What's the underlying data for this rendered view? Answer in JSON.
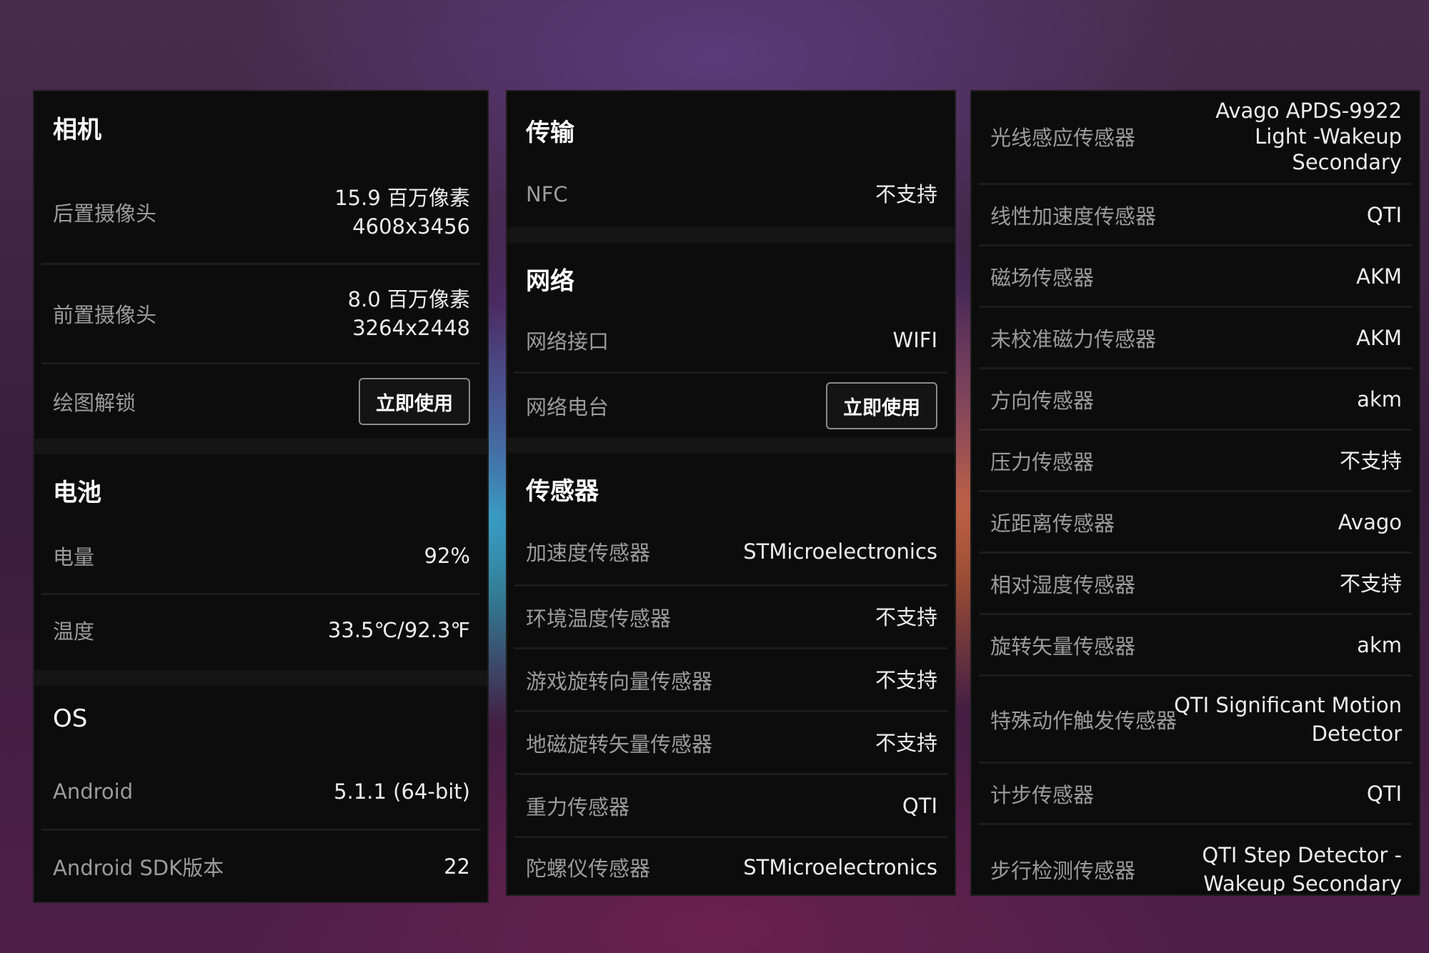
{
  "camera": {
    "title": "相机",
    "rear": {
      "label": "后置摄像头",
      "line1": "15.9 百万像素",
      "line2": "4608x3456"
    },
    "front": {
      "label": "前置摄像头",
      "line1": "8.0 百万像素",
      "line2": "3264x2448"
    },
    "unlock": {
      "label": "绘图解锁",
      "button": "立即使用"
    }
  },
  "battery": {
    "title": "电池",
    "level": {
      "label": "电量",
      "value": "92%"
    },
    "temp": {
      "label": "温度",
      "value": "33.5℃/92.3℉"
    }
  },
  "os": {
    "title": "OS",
    "android": {
      "label": "Android",
      "value": "5.1.1 (64-bit)"
    },
    "sdk": {
      "label": "Android SDK版本",
      "value": "22"
    }
  },
  "transfer": {
    "title": "传输",
    "nfc": {
      "label": "NFC",
      "value": "不支持"
    }
  },
  "network": {
    "title": "网络",
    "iface": {
      "label": "网络接口",
      "value": "WIFI"
    },
    "radio": {
      "label": "网络电台",
      "button": "立即使用"
    }
  },
  "sensors": {
    "title": "传感器",
    "items": [
      {
        "label": "加速度传感器",
        "value": "STMicroelectronics"
      },
      {
        "label": "环境温度传感器",
        "value": "不支持"
      },
      {
        "label": "游戏旋转向量传感器",
        "value": "不支持"
      },
      {
        "label": "地磁旋转矢量传感器",
        "value": "不支持"
      },
      {
        "label": "重力传感器",
        "value": "QTI"
      },
      {
        "label": "陀螺仪传感器",
        "value": "STMicroelectronics"
      }
    ]
  },
  "sensors2": {
    "light": {
      "label": "光线感应传感器",
      "line1": "Avago APDS-9922",
      "line2": "Light -Wakeup",
      "line3": "Secondary"
    },
    "items": [
      {
        "label": "线性加速度传感器",
        "value": "QTI"
      },
      {
        "label": "磁场传感器",
        "value": "AKM"
      },
      {
        "label": "未校准磁力传感器",
        "value": "AKM"
      },
      {
        "label": "方向传感器",
        "value": "akm"
      },
      {
        "label": "压力传感器",
        "value": "不支持"
      },
      {
        "label": "近距离传感器",
        "value": "Avago"
      },
      {
        "label": "相对湿度传感器",
        "value": "不支持"
      },
      {
        "label": "旋转矢量传感器",
        "value": "akm"
      }
    ],
    "motion": {
      "label": "特殊动作触发传感器",
      "line1": "QTI Significant Motion",
      "line2": "Detector"
    },
    "step": {
      "label": "计步传感器",
      "value": "QTI"
    },
    "stepdetect": {
      "label": "步行检测传感器",
      "line1": "QTI Step Detector -",
      "line2": "Wakeup Secondary"
    }
  }
}
